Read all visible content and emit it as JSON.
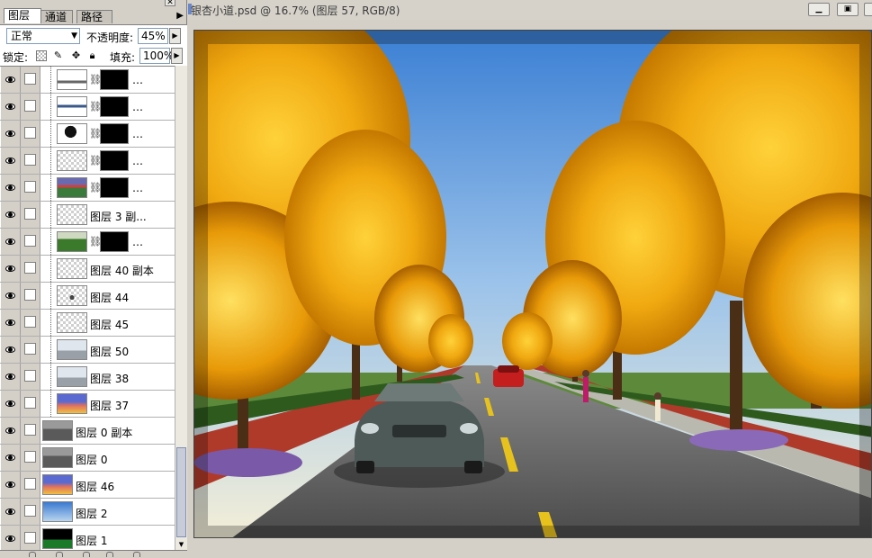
{
  "layers_panel": {
    "tabs": [
      {
        "label": "图层",
        "active": true
      },
      {
        "label": "通道",
        "active": false
      },
      {
        "label": "路径",
        "active": false
      }
    ],
    "blend_mode": "正常",
    "opacity_label": "不透明度:",
    "opacity_value": "45%",
    "lock_label": "锁定:",
    "fill_label": "填充:",
    "fill_value": "100%",
    "layers": [
      {
        "name": "…",
        "indent": true,
        "thumb": "landscape-strip",
        "has_mask": true
      },
      {
        "name": "…",
        "indent": true,
        "thumb": "clouds-strip",
        "has_mask": true
      },
      {
        "name": "…",
        "indent": true,
        "thumb": "tree-silhouette",
        "has_mask": true
      },
      {
        "name": "…",
        "indent": true,
        "thumb": "transparent",
        "has_mask": true
      },
      {
        "name": "…",
        "indent": true,
        "thumb": "landscape-color",
        "has_mask": true
      },
      {
        "name": "图层 3 副...",
        "indent": true,
        "thumb": "transparent",
        "has_mask": false
      },
      {
        "name": "…",
        "indent": true,
        "thumb": "green-landscape",
        "has_mask": true
      },
      {
        "name": "图层 40 副本",
        "indent": true,
        "thumb": "transparent",
        "has_mask": false
      },
      {
        "name": "图层 44",
        "indent": true,
        "thumb": "small-figure",
        "has_mask": false
      },
      {
        "name": "图层 45",
        "indent": true,
        "thumb": "transparent",
        "has_mask": false
      },
      {
        "name": "图层 50",
        "indent": true,
        "thumb": "road-light",
        "has_mask": false
      },
      {
        "name": "图层 38",
        "indent": true,
        "thumb": "road-light",
        "has_mask": false
      },
      {
        "name": "图层 37",
        "indent": true,
        "thumb": "sunset-sky",
        "has_mask": false
      },
      {
        "name": "图层 0 副本",
        "indent": false,
        "thumb": "road-grey",
        "has_mask": false
      },
      {
        "name": "图层 0",
        "indent": false,
        "thumb": "road-grey",
        "has_mask": false
      },
      {
        "name": "图层 46",
        "indent": false,
        "thumb": "sunset-sky",
        "has_mask": false
      },
      {
        "name": "图层 2",
        "indent": false,
        "thumb": "blue-sky",
        "has_mask": false
      },
      {
        "name": "图层 1",
        "indent": false,
        "thumb": "dark-green",
        "has_mask": false
      }
    ]
  },
  "document": {
    "title": "银杏小道.psd @ 16.7% (图层 57, RGB/8)",
    "canvas_subject": "autumn ginkgo tree-lined road with a grey convertible car"
  }
}
